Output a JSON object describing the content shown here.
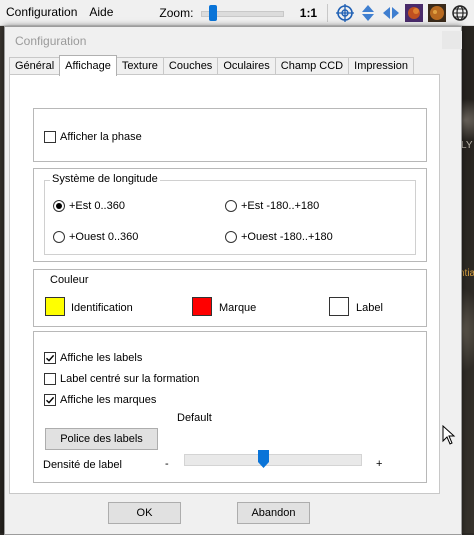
{
  "menubar": {
    "items": [
      "Configuration",
      "Aide"
    ],
    "zoom_label": "Zoom:",
    "zoom_ratio": "1:1",
    "zoom_level": 0.12
  },
  "background": {
    "snippets": [
      "LY",
      "ntia"
    ]
  },
  "dialog": {
    "title": "Configuration",
    "tabs": [
      {
        "label": "Général",
        "active": false
      },
      {
        "label": "Affichage",
        "active": true
      },
      {
        "label": "Texture",
        "active": false
      },
      {
        "label": "Couches",
        "active": false
      },
      {
        "label": "Oculaires",
        "active": false
      },
      {
        "label": "Champ CCD",
        "active": false
      },
      {
        "label": "Impression",
        "active": false
      }
    ],
    "phase": {
      "label": "Afficher la phase",
      "checked": false
    },
    "longitude": {
      "legend": "Système de longitude",
      "options": [
        {
          "label": "+Est 0..360",
          "selected": true
        },
        {
          "label": "+Est -180..+180",
          "selected": false
        },
        {
          "label": "+Ouest 0..360",
          "selected": false
        },
        {
          "label": "+Ouest -180..+180",
          "selected": false
        }
      ]
    },
    "couleur": {
      "title": "Couleur",
      "items": [
        {
          "label": "Identification",
          "color": "#ffff00"
        },
        {
          "label": "Marque",
          "color": "#ff0000"
        },
        {
          "label": "Label",
          "color": "#ffffff"
        }
      ]
    },
    "labels": {
      "affiche_labels": {
        "label": "Affiche les labels",
        "checked": true
      },
      "label_centre": {
        "label": "Label centré sur la formation",
        "checked": false
      },
      "affiche_marques": {
        "label": "Affiche les marques",
        "checked": true
      },
      "default_text": "Default",
      "font_button": "Police des labels",
      "density_label": "Densité de label",
      "minus": "-",
      "plus": "+",
      "density_level": 0.5
    },
    "ok": "OK",
    "cancel": "Abandon"
  }
}
